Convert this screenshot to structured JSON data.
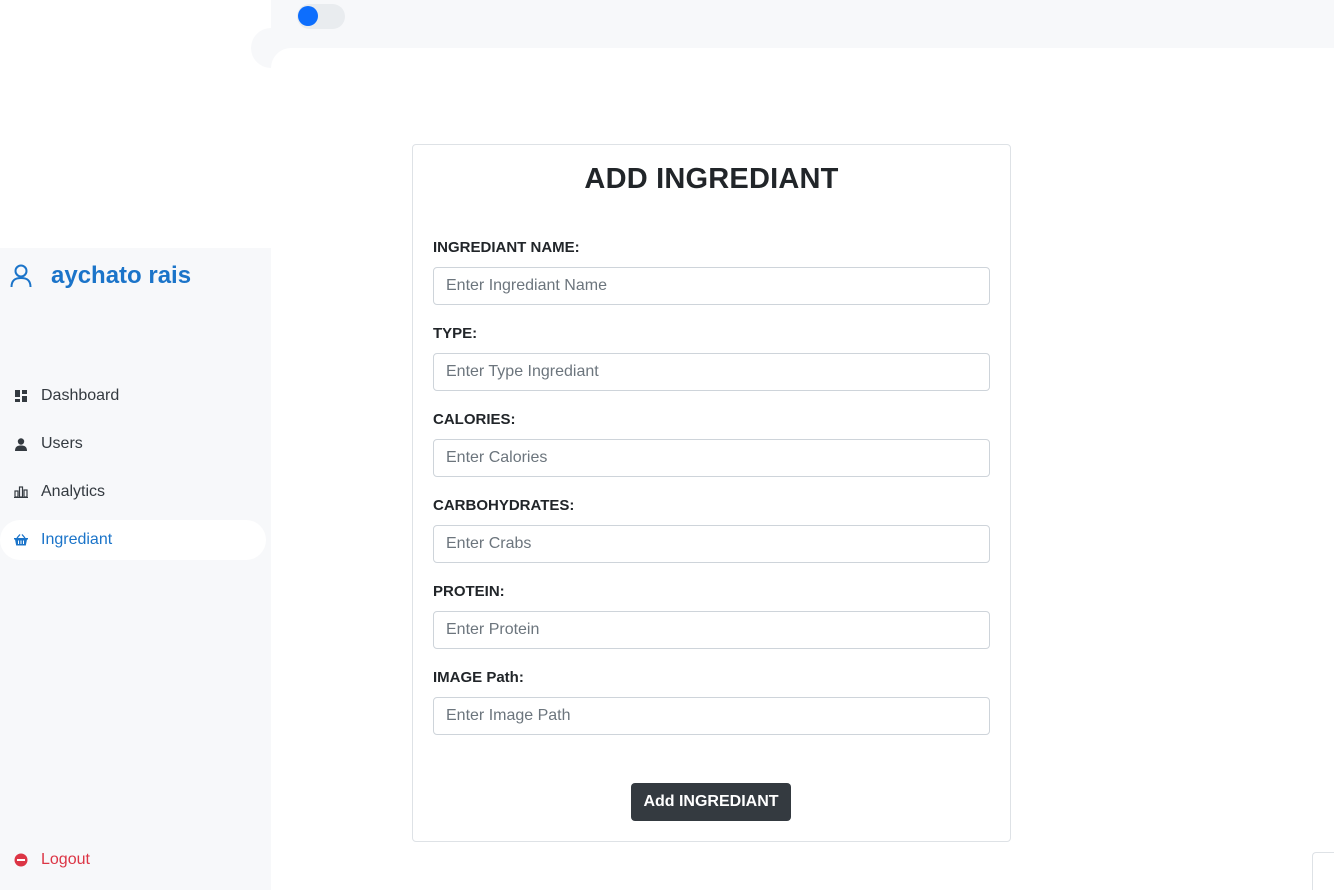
{
  "topbar": {
    "theme_toggle": "on"
  },
  "sidebar": {
    "user_name": "aychato rais",
    "items": [
      {
        "label": "Dashboard",
        "icon": "dashboard-icon"
      },
      {
        "label": "Users",
        "icon": "user-icon"
      },
      {
        "label": "Analytics",
        "icon": "bar-chart-icon"
      },
      {
        "label": "Ingrediant",
        "icon": "basket-icon",
        "active": true
      }
    ],
    "logout_label": "Logout"
  },
  "form": {
    "title": "ADD INGREDIANT",
    "fields": [
      {
        "label": "INGREDIANT NAME:",
        "placeholder": "Enter Ingrediant Name",
        "value": ""
      },
      {
        "label": "TYPE:",
        "placeholder": "Enter Type Ingrediant",
        "value": ""
      },
      {
        "label": "CALORIES:",
        "placeholder": "Enter Calories",
        "value": ""
      },
      {
        "label": "CARBOHYDRATES:",
        "placeholder": "Enter Crabs",
        "value": ""
      },
      {
        "label": "PROTEIN:",
        "placeholder": "Enter Protein",
        "value": ""
      },
      {
        "label": "IMAGE Path:",
        "placeholder": "Enter Image Path",
        "value": ""
      }
    ],
    "submit_label": "Add INGREDIANT"
  },
  "colors": {
    "accent": "#1b74c9",
    "toggle": "#0d6efd",
    "logout": "#dc3545",
    "button": "#343a40"
  }
}
